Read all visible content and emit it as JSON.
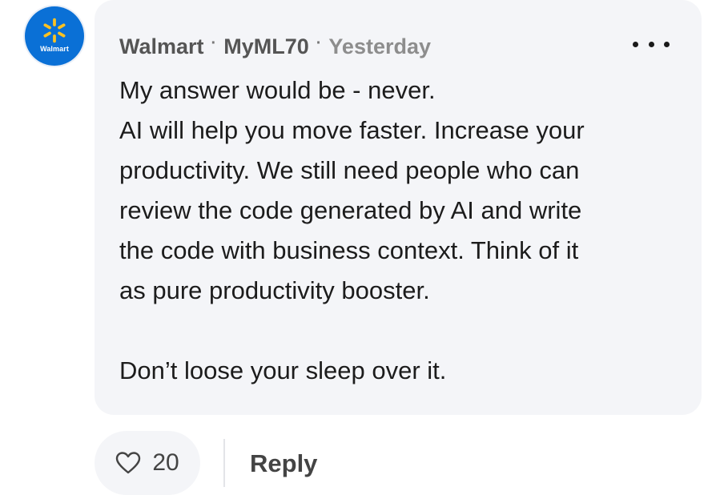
{
  "post": {
    "avatar_text": "Walmart",
    "company": "Walmart",
    "username": "MyML70",
    "separator": "·",
    "timestamp": "Yesterday",
    "lines": [
      "My answer would be - never.",
      "AI will help you move faster. Increase your",
      "productivity. We still need people who can",
      "review the code generated by AI and write",
      "the code with business context. Think of it",
      "as pure productivity booster."
    ],
    "closing": "Don’t loose your sleep over it."
  },
  "actions": {
    "like_count": "20",
    "reply_label": "Reply"
  },
  "icons": {
    "avatar_logo": "walmart-spark-icon",
    "more": "more-horizontal-icon",
    "like": "heart-icon"
  },
  "colors": {
    "brand_blue": "#0a70d6",
    "spark_yellow": "#ffc220",
    "bubble_bg": "#f4f5f8"
  }
}
